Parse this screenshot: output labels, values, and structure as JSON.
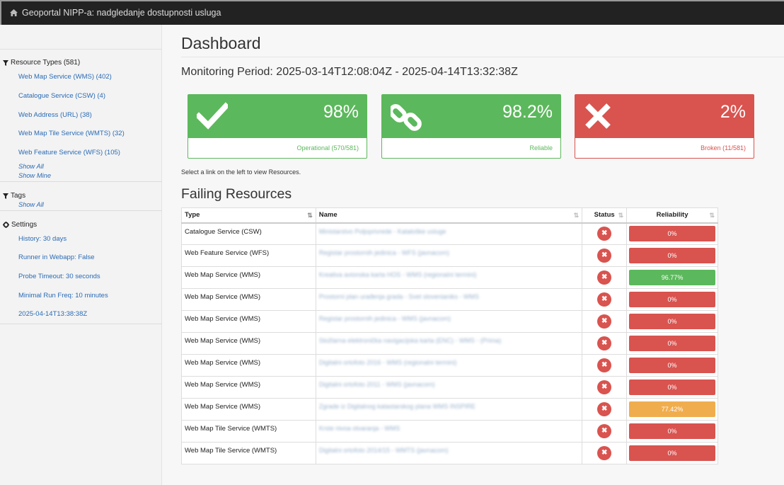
{
  "navbar": {
    "title": "Geoportal NIPP-a: nadgledanje dostupnosti usluga",
    "icon": "home-icon"
  },
  "sidebar": {
    "resource_types": {
      "heading": "Resource Types (581)",
      "items": [
        {
          "label": "Web Map Service (WMS) (402)"
        },
        {
          "label": "Catalogue Service (CSW) (4)"
        },
        {
          "label": "Web Address (URL) (38)"
        },
        {
          "label": "Web Map Tile Service (WMTS) (32)"
        },
        {
          "label": "Web Feature Service (WFS) (105)"
        }
      ],
      "show_all": "Show All",
      "show_mine": "Show Mine"
    },
    "tags": {
      "heading": "Tags",
      "show_all": "Show All"
    },
    "settings": {
      "heading": "Settings",
      "items": [
        {
          "label": "History: 30 days"
        },
        {
          "label": "Runner in Webapp: False"
        },
        {
          "label": "Probe Timeout: 30 seconds"
        },
        {
          "label": "Minimal Run Freq: 10 minutes"
        },
        {
          "label": "2025-04-14T13:38:38Z"
        }
      ]
    }
  },
  "main": {
    "title": "Dashboard",
    "period": "Monitoring Period: 2025-03-14T12:08:04Z - 2025-04-14T13:32:38Z",
    "cards": [
      {
        "value": "98%",
        "caption": "Operational (570/581)",
        "icon": "check-icon",
        "color": "#5cb85c"
      },
      {
        "value": "98.2%",
        "caption": "Reliable",
        "icon": "link-icon",
        "color": "#5cb85c"
      },
      {
        "value": "2%",
        "caption": "Broken (11/581)",
        "icon": "times-icon",
        "color": "#d9534f"
      }
    ],
    "hint": "Select a link on the left to view Resources.",
    "failing_title": "Failing Resources",
    "table": {
      "headers": {
        "type": "Type",
        "name": "Name",
        "status": "Status",
        "reliability": "Reliability"
      },
      "rows": [
        {
          "type": "Catalogue Service (CSW)",
          "name": "Ministarstvo Poljoprivrede - Kataloške usluge",
          "reliability": "0%",
          "reliability_value": 0
        },
        {
          "type": "Web Feature Service (WFS)",
          "name": "Registar prostornih jedinica - WFS (javnacom)",
          "reliability": "0%",
          "reliability_value": 0
        },
        {
          "type": "Web Map Service (WMS)",
          "name": "Kreativa avionska karta HOS - WMS (regionalni termini)",
          "reliability": "96.77%",
          "reliability_value": 96.77
        },
        {
          "type": "Web Map Service (WMS)",
          "name": "Prostorni plan urađenja grada - Svet slovenianiks - WMS",
          "reliability": "0%",
          "reliability_value": 0
        },
        {
          "type": "Web Map Service (WMS)",
          "name": "Registar prostornih jedinica - WMS (javnacom)",
          "reliability": "0%",
          "reliability_value": 0
        },
        {
          "type": "Web Map Service (WMS)",
          "name": "Stožlarna elektronička navigacijska karta (ENC) - WMS - (Prima)",
          "reliability": "0%",
          "reliability_value": 0
        },
        {
          "type": "Web Map Service (WMS)",
          "name": "Digitalni ortofoto 2016 - WMS (regionalni termini)",
          "reliability": "0%",
          "reliability_value": 0
        },
        {
          "type": "Web Map Service (WMS)",
          "name": "Digitalni ortofoto 2011 - WMS (javnacom)",
          "reliability": "0%",
          "reliability_value": 0
        },
        {
          "type": "Web Map Service (WMS)",
          "name": "Zgrade iz Digitalnog katastarskog plana WMS INSPIRE",
          "reliability": "77.42%",
          "reliability_value": 77.42
        },
        {
          "type": "Web Map Tile Service (WMTS)",
          "name": "Krste nivoa otvaranja - WMS",
          "reliability": "0%",
          "reliability_value": 0
        },
        {
          "type": "Web Map Tile Service (WMTS)",
          "name": "Digitalni ortofoto 2014/15 - WMTS (javnacom)",
          "reliability": "0%",
          "reliability_value": 0
        }
      ]
    }
  }
}
